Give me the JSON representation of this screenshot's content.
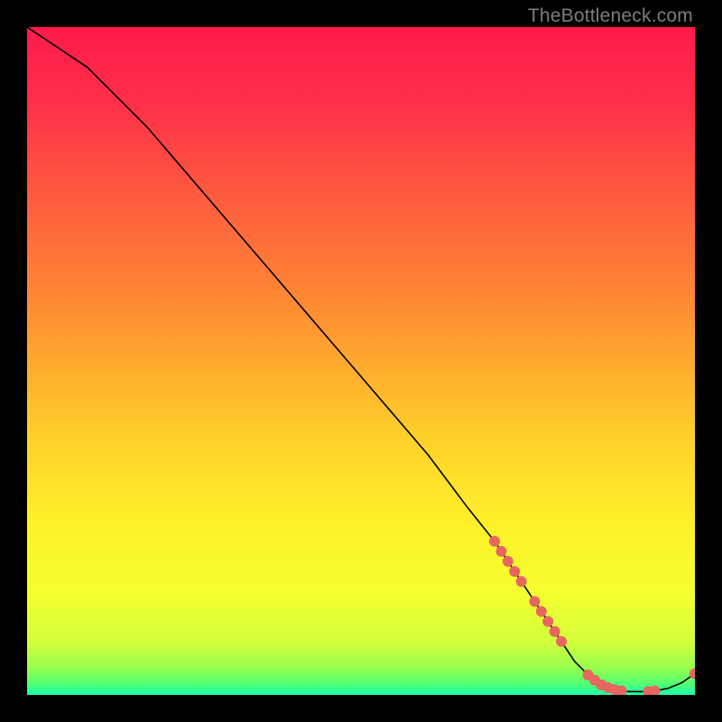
{
  "watermark": "TheBottleneck.com",
  "chart_data": {
    "type": "line",
    "title": "",
    "xlabel": "",
    "ylabel": "",
    "xlim": [
      0,
      100
    ],
    "ylim": [
      0,
      100
    ],
    "grid": false,
    "legend": false,
    "curve": {
      "x": [
        0,
        3,
        6,
        9,
        12,
        18,
        24,
        30,
        36,
        42,
        48,
        54,
        60,
        66,
        70,
        72,
        74,
        76,
        78,
        80,
        82,
        84,
        86,
        88,
        90,
        92,
        94,
        96,
        98,
        100
      ],
      "y": [
        100,
        98,
        96,
        94,
        91,
        85,
        78,
        71,
        64,
        57,
        50,
        43,
        36,
        28,
        23,
        20,
        17,
        14,
        11,
        8,
        5,
        3,
        1.5,
        0.8,
        0.5,
        0.5,
        0.6,
        1.0,
        1.8,
        3.2
      ]
    },
    "points": {
      "color": "#e7665f",
      "x": [
        70,
        71,
        72,
        73,
        74,
        76,
        77,
        78,
        79,
        80,
        84,
        85,
        86,
        87,
        88,
        89,
        93,
        94,
        100
      ],
      "y": [
        23,
        21.5,
        20,
        18.5,
        17,
        14,
        12.5,
        11,
        9.5,
        8,
        3,
        2.2,
        1.5,
        1.1,
        0.8,
        0.6,
        0.5,
        0.6,
        3.2
      ]
    },
    "gradient_stops": [
      {
        "offset": 0.0,
        "color": "#ff1a4b"
      },
      {
        "offset": 0.12,
        "color": "#ff3149"
      },
      {
        "offset": 0.25,
        "color": "#ff5a3f"
      },
      {
        "offset": 0.38,
        "color": "#ff8035"
      },
      {
        "offset": 0.5,
        "color": "#ffa82e"
      },
      {
        "offset": 0.62,
        "color": "#ffd22a"
      },
      {
        "offset": 0.74,
        "color": "#fff029"
      },
      {
        "offset": 0.85,
        "color": "#f4ff2f"
      },
      {
        "offset": 0.92,
        "color": "#d2ff3a"
      },
      {
        "offset": 0.96,
        "color": "#97ff4e"
      },
      {
        "offset": 0.985,
        "color": "#4cff76"
      },
      {
        "offset": 1.0,
        "color": "#1cffb0"
      }
    ]
  }
}
